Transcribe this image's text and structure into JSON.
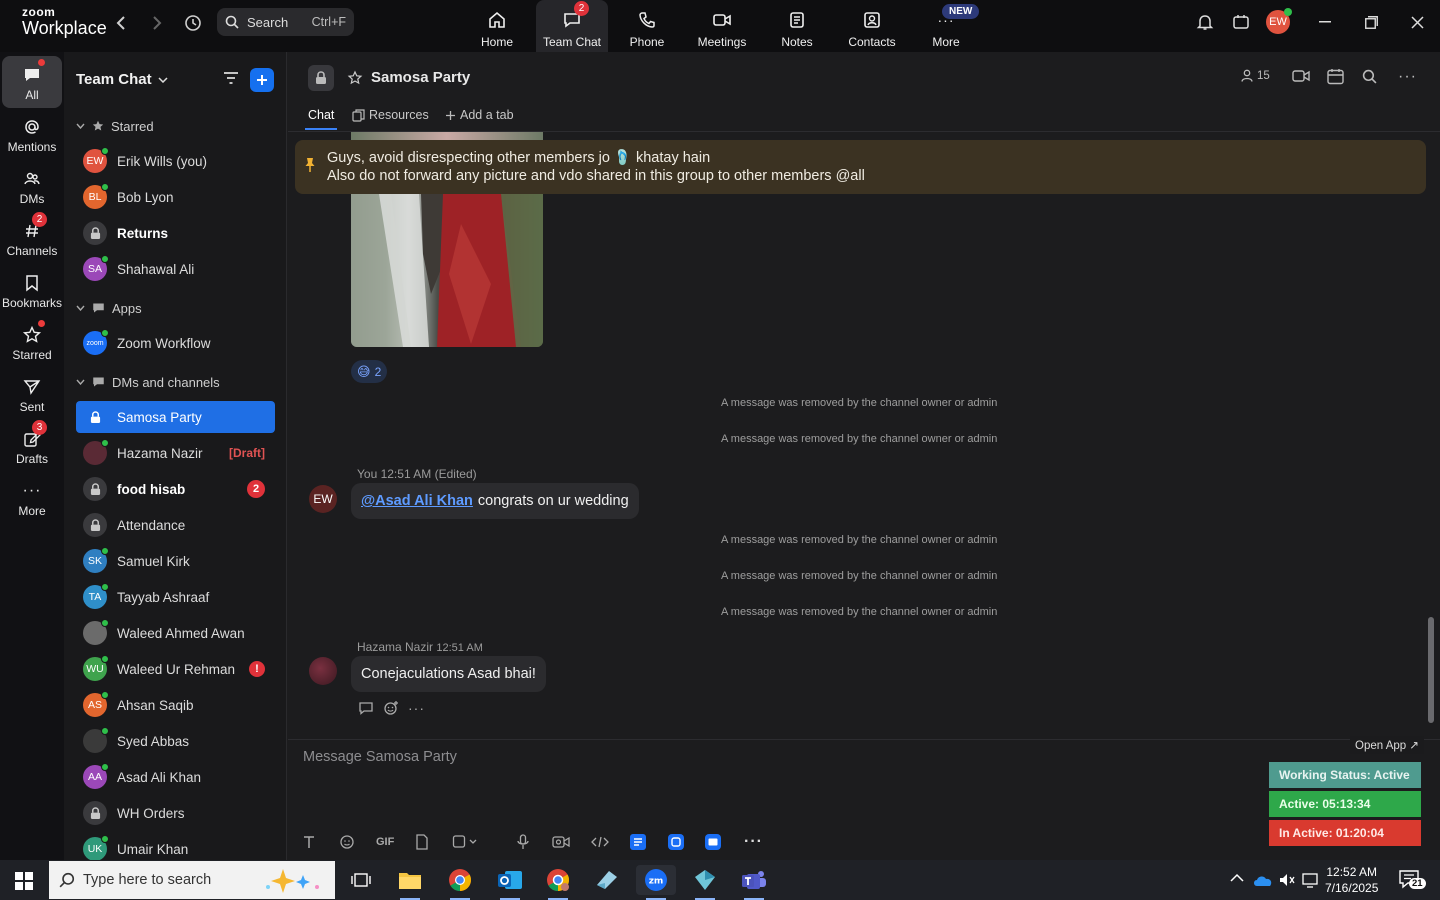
{
  "topbar": {
    "brand_top": "zoom",
    "brand_bottom": "Workplace",
    "search_label": "Search",
    "search_shortcut": "Ctrl+F",
    "nav": [
      {
        "label": "Home",
        "icon": "home-icon"
      },
      {
        "label": "Team Chat",
        "icon": "chat-icon",
        "badge": "2",
        "active": true
      },
      {
        "label": "Phone",
        "icon": "phone-icon"
      },
      {
        "label": "Meetings",
        "icon": "video-icon"
      },
      {
        "label": "Notes",
        "icon": "notes-icon"
      },
      {
        "label": "Contacts",
        "icon": "contacts-icon"
      },
      {
        "label": "More",
        "icon": "more-icon",
        "pill": "NEW"
      }
    ],
    "profile_initials": "EW"
  },
  "rail": [
    {
      "label": "All",
      "icon": "chat-bubble-icon",
      "active": true
    },
    {
      "label": "Mentions",
      "icon": "at-icon"
    },
    {
      "label": "DMs",
      "icon": "people-icon"
    },
    {
      "label": "Channels",
      "icon": "hash-icon",
      "badge": "2"
    },
    {
      "label": "Bookmarks",
      "icon": "bookmark-icon"
    },
    {
      "label": "Starred",
      "icon": "star-icon"
    },
    {
      "label": "Sent",
      "icon": "send-icon"
    },
    {
      "label": "Drafts",
      "icon": "draft-icon",
      "badge": "3"
    },
    {
      "label": "More",
      "icon": "ellipsis-icon"
    }
  ],
  "sidebar": {
    "title": "Team Chat",
    "sections": {
      "starred": "Starred",
      "apps": "Apps",
      "dms": "DMs and channels"
    },
    "starred": [
      {
        "name": "Erik Wills (you)",
        "initials": "EW",
        "color": "#e0533f"
      },
      {
        "name": "Bob Lyon",
        "initials": "BL",
        "color": "#e2662e"
      },
      {
        "name": "Returns",
        "locked": true,
        "bold": true
      },
      {
        "name": "Shahawal Ali",
        "initials": "SA",
        "color": "#9b48b8"
      }
    ],
    "apps": [
      {
        "name": "Zoom Workflow",
        "initials": "zoom",
        "color": "#1a6ef5"
      }
    ],
    "dms": [
      {
        "name": "Samosa Party",
        "locked": true,
        "selected": true
      },
      {
        "name": "Hazama Nazir",
        "initials": "",
        "color": "#5a2a35",
        "draft": "[Draft]"
      },
      {
        "name": "food hisab",
        "locked": true,
        "bold": true,
        "count": "2"
      },
      {
        "name": "Attendance",
        "locked": true
      },
      {
        "name": "Samuel Kirk",
        "initials": "SK",
        "color": "#2f7fc1"
      },
      {
        "name": "Tayyab Ashraaf",
        "initials": "TA",
        "color": "#2f8fc9"
      },
      {
        "name": "Waleed Ahmed Awan",
        "initials": "",
        "color": "#6b6b6b"
      },
      {
        "name": "Waleed Ur Rehman",
        "initials": "WU",
        "color": "#3fa34d",
        "alert": "!"
      },
      {
        "name": "Ahsan Saqib",
        "initials": "AS",
        "color": "#e2662e"
      },
      {
        "name": "Syed Abbas",
        "initials": "",
        "color": "#3a3a3a"
      },
      {
        "name": "Asad Ali Khan",
        "initials": "AA",
        "color": "#9b48b8"
      },
      {
        "name": "WH Orders",
        "locked": true
      },
      {
        "name": "Umair Khan",
        "initials": "UK",
        "color": "#2f9a7a"
      }
    ]
  },
  "channel": {
    "title": "Samosa Party",
    "members": "15",
    "tabs": {
      "chat": "Chat",
      "resources": "Resources",
      "add": "Add a tab"
    },
    "pinned_line1": "Guys, avoid disrespecting other members jo 🩴 khatay hain",
    "pinned_line2": "Also do not forward any picture and vdo shared in this group to other members @all",
    "reaction_emoji": "😅",
    "reaction_count": "2",
    "removed_text": "A message was removed by the channel owner or admin",
    "msg1": {
      "meta": "You 12:51 AM (Edited)",
      "avatar": "EW",
      "mention": "@Asad Ali Khan",
      "text": "congrats on ur wedding"
    },
    "msg2": {
      "author": "Hazama Nazir",
      "time": "12:51 AM",
      "text": "Conejaculations Asad bhai!"
    },
    "composer_placeholder": "Message Samosa Party"
  },
  "widget": {
    "open_app": "Open App ↗",
    "status": "Working Status: Active",
    "active": "Active: 05:13:34",
    "inactive": "In Active: 01:20:04",
    "colors": {
      "status": "#4f9b8f",
      "active": "#2ea84a",
      "inactive": "#d93a2f"
    }
  },
  "taskbar": {
    "search_placeholder": "Type here to search",
    "time": "12:52 AM",
    "date": "7/16/2025",
    "notif_count": "21"
  }
}
